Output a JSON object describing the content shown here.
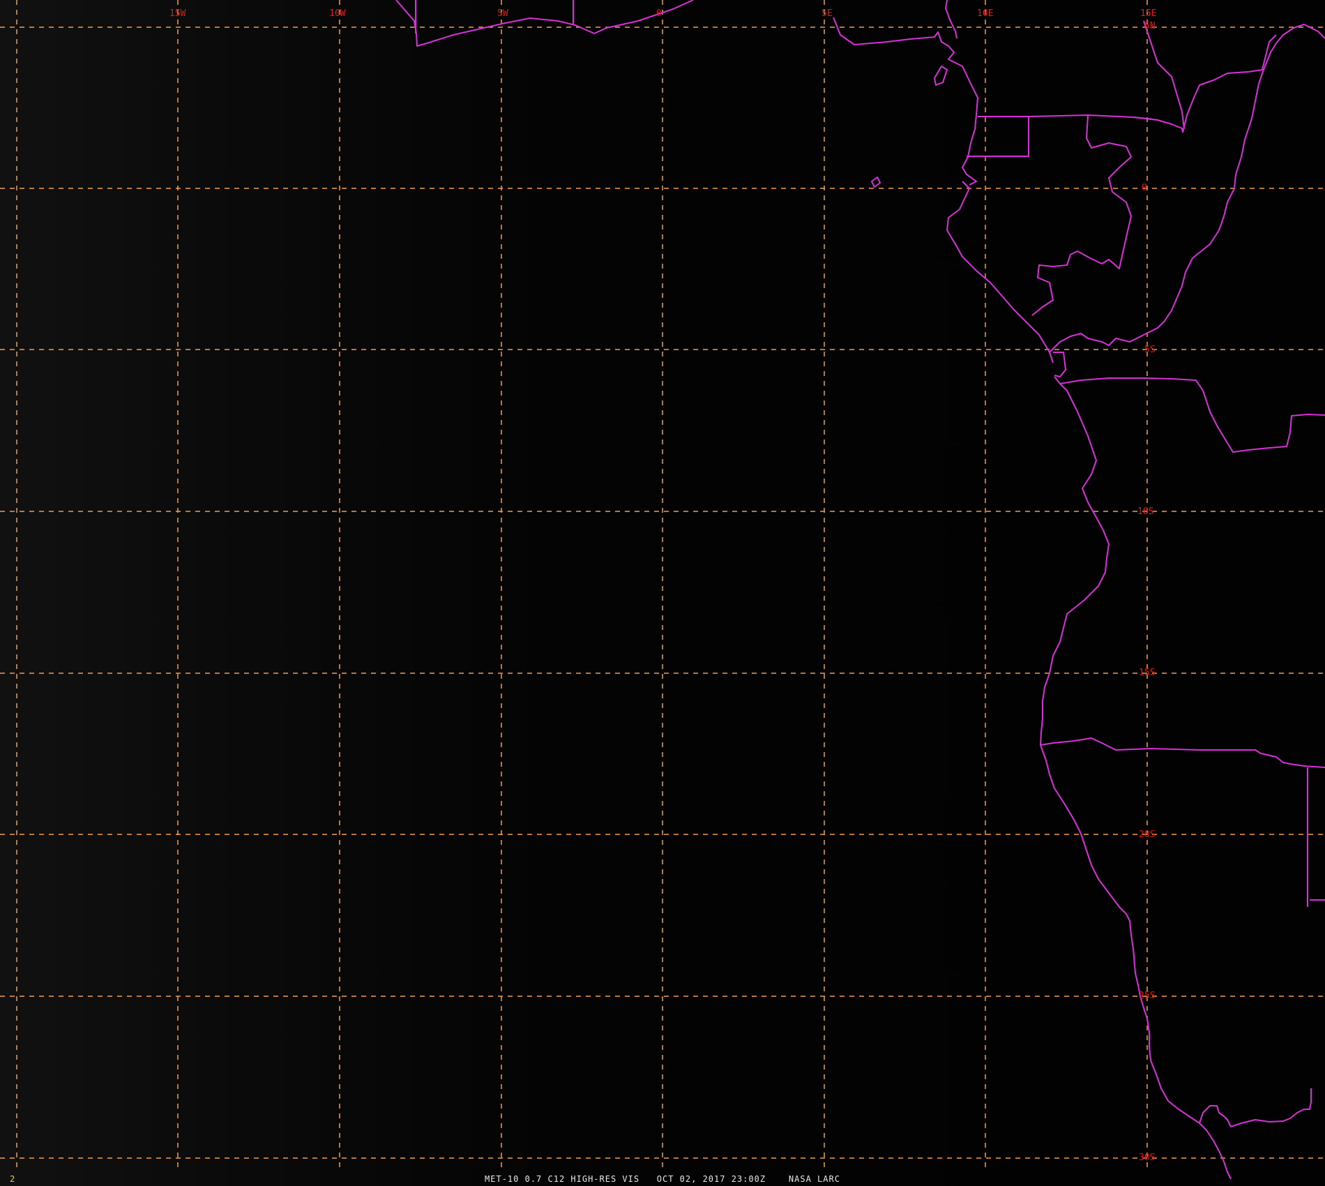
{
  "map": {
    "longitude_labels": [
      "15W",
      "10W",
      "5W",
      "0",
      "5E",
      "10E",
      "15E"
    ],
    "latitude_labels": [
      "5N",
      "0",
      "5S",
      "10S",
      "15S",
      "20S",
      "25S",
      "30S"
    ],
    "colors": {
      "background": "#000000",
      "grid": "#f0a050",
      "coastline": "#d830d8",
      "grid_labels": "#e01818",
      "caption": "#e8e8e8",
      "frame_number": "#e8d020"
    }
  },
  "footer": {
    "caption": "MET-10 0.7 C12 HIGH-RES VIS   OCT 02, 2017 23:00Z    NASA LARC",
    "frame_number": "2"
  }
}
